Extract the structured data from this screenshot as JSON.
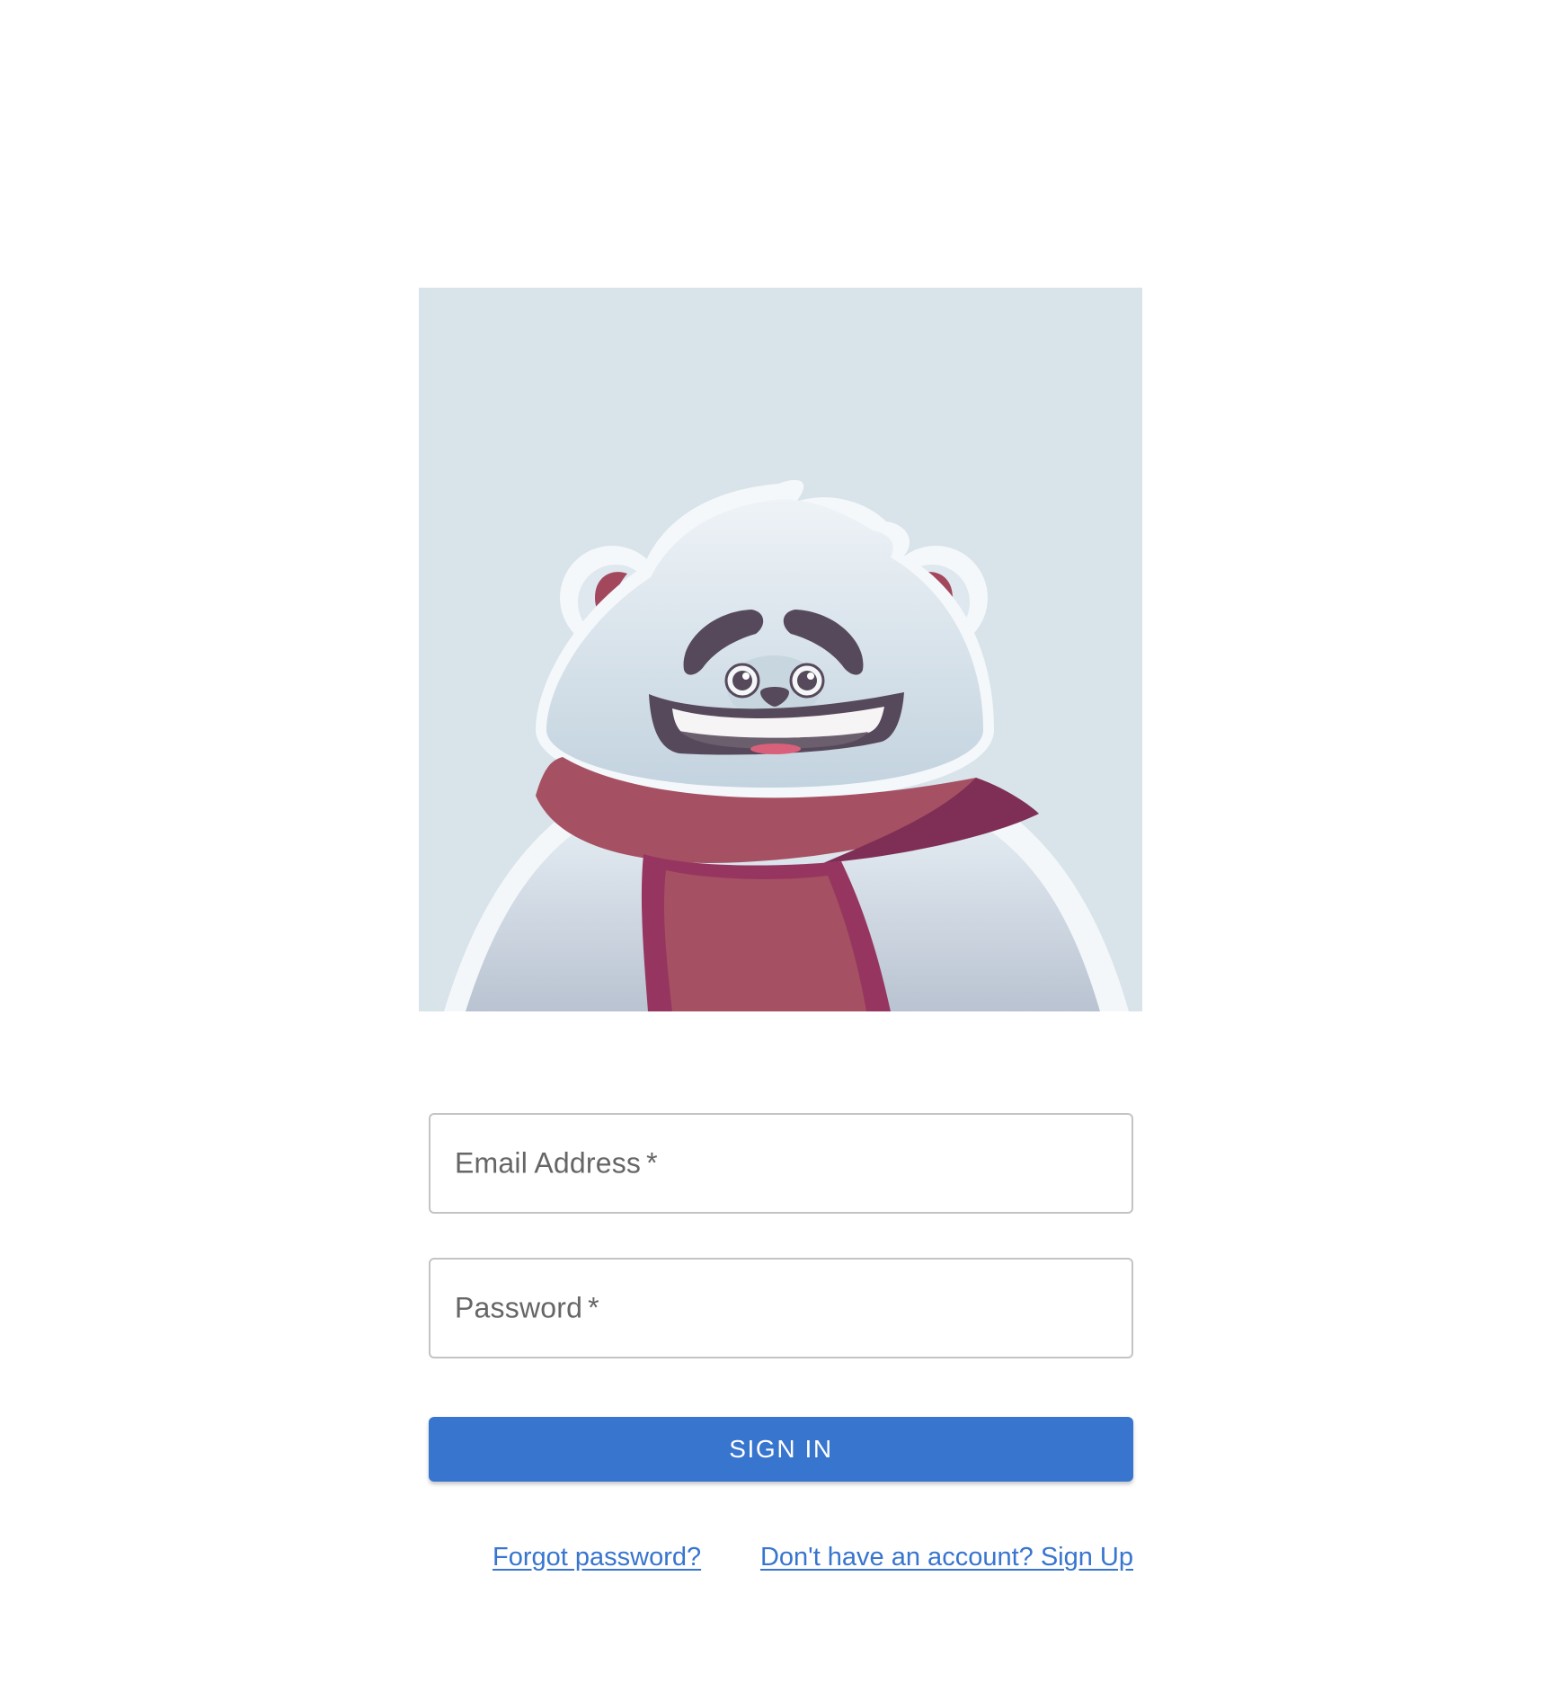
{
  "illustration": {
    "name": "polar-bear-with-scarf",
    "colors": {
      "background": "#d9e3ea",
      "fur": "#e7eef4",
      "fur_shadow": "#c7d6e0",
      "scarf": "#a65163",
      "scarf_dark": "#963660",
      "eyebrows": "#56495b",
      "ear_inner": "#a3485c"
    }
  },
  "form": {
    "email_label": "Email Address",
    "password_label": "Password",
    "required_mark": "*",
    "email_value": "",
    "password_value": "",
    "sign_in_label": "SIGN IN"
  },
  "links": {
    "forgot_password": "Forgot password?",
    "sign_up": "Don't have an account? Sign Up"
  },
  "colors": {
    "accent": "#3875cf",
    "input_border": "#c4c4c4",
    "label_text": "#666666"
  }
}
